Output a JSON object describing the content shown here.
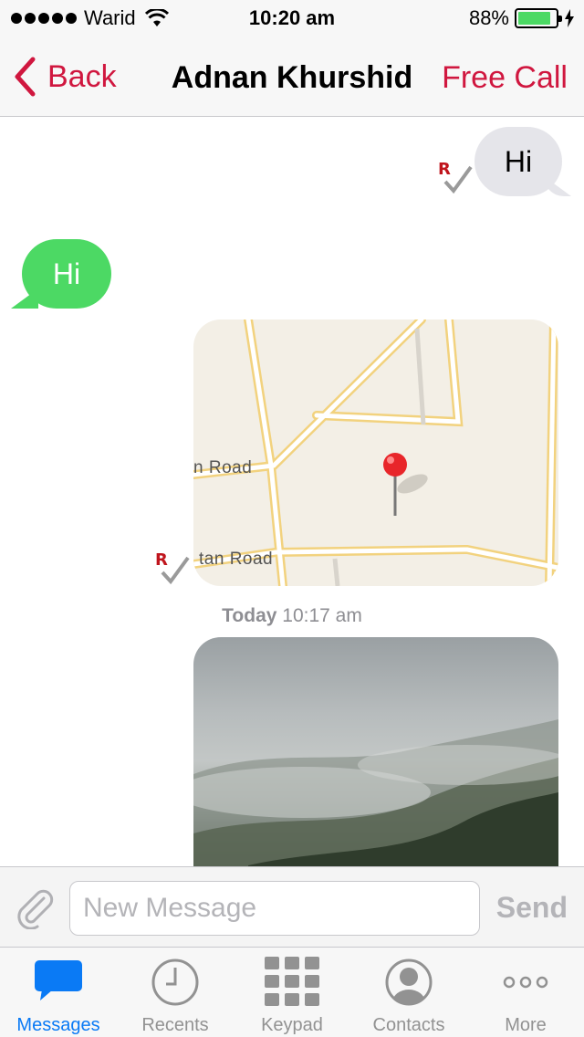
{
  "status_bar": {
    "carrier": "Warid",
    "time": "10:20 am",
    "battery_percent": "88%",
    "battery_level": 0.88,
    "battery_color": "#4cd964"
  },
  "nav": {
    "back_label": "Back",
    "title": "Adnan Khurshid",
    "call_label": "Free Call",
    "accent_color": "#d0173f"
  },
  "messages": {
    "outgoing_text": "Hi",
    "incoming_text": "Hi",
    "receipt_mark": "R",
    "map_road_1": "n Road",
    "map_road_2": "tan Road",
    "timestamp_day": "Today",
    "timestamp_time": "10:17 am"
  },
  "input": {
    "placeholder": "New Message",
    "value": "",
    "send_label": "Send"
  },
  "tabs": [
    {
      "label": "Messages",
      "icon": "speech-bubble-icon",
      "active": true
    },
    {
      "label": "Recents",
      "icon": "clock-icon",
      "active": false
    },
    {
      "label": "Keypad",
      "icon": "keypad-icon",
      "active": false
    },
    {
      "label": "Contacts",
      "icon": "contact-icon",
      "active": false
    },
    {
      "label": "More",
      "icon": "more-dots-icon",
      "active": false
    }
  ]
}
